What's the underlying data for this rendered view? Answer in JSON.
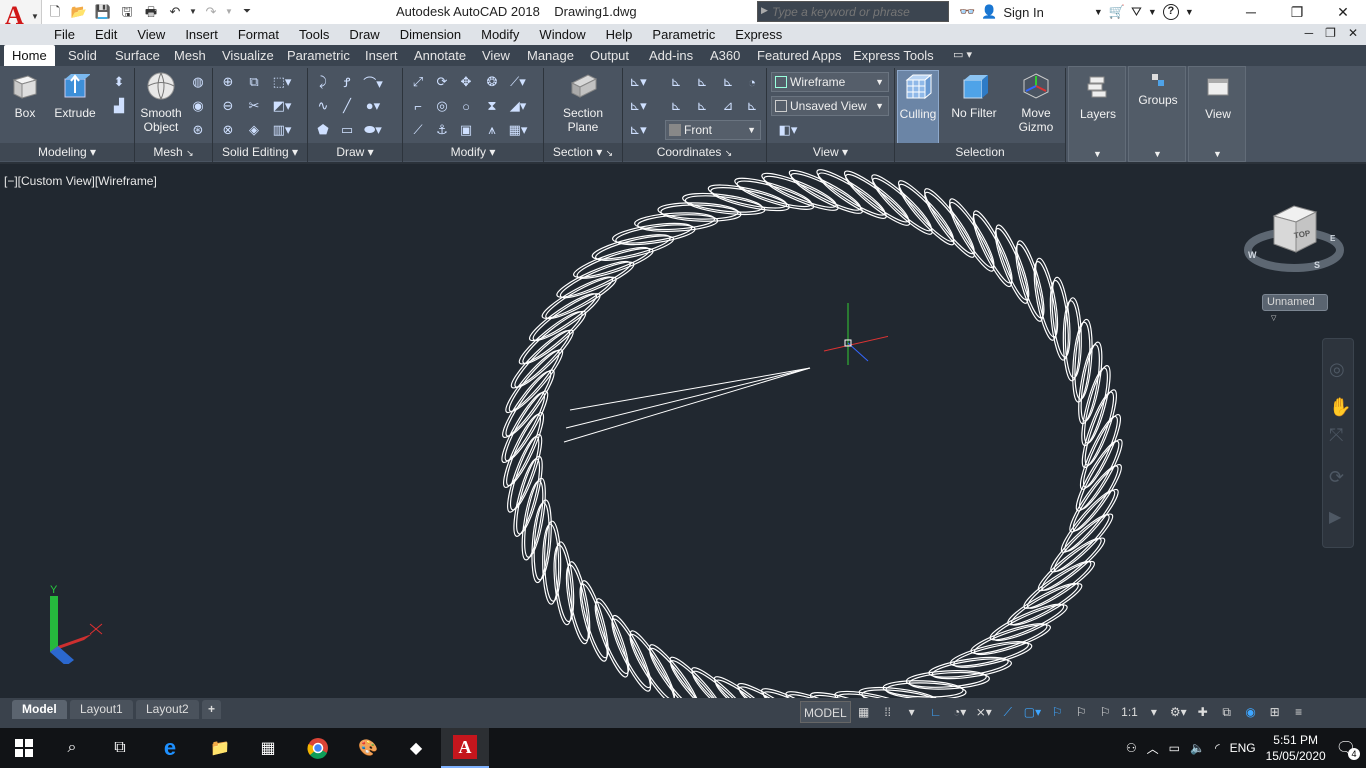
{
  "app": {
    "title": "Autodesk AutoCAD 2018",
    "document": "Drawing1.dwg",
    "logo_letter": "A"
  },
  "search": {
    "placeholder": "Type a keyword or phrase"
  },
  "account": {
    "sign_in": "Sign In"
  },
  "menu": [
    "File",
    "Edit",
    "View",
    "Insert",
    "Format",
    "Tools",
    "Draw",
    "Dimension",
    "Modify",
    "Window",
    "Help",
    "Parametric",
    "Express"
  ],
  "tabs": [
    "Home",
    "Solid",
    "Surface",
    "Mesh",
    "Visualize",
    "Parametric",
    "Insert",
    "Annotate",
    "View",
    "Manage",
    "Output",
    "Add-ins",
    "A360",
    "Featured Apps",
    "Express Tools"
  ],
  "active_tab": "Home",
  "ribbon": {
    "modeling": {
      "title": "Modeling",
      "box": "Box",
      "extrude": "Extrude"
    },
    "mesh": {
      "title": "Mesh",
      "smooth_object_1": "Smooth",
      "smooth_object_2": "Object"
    },
    "solid_editing": {
      "title": "Solid Editing"
    },
    "draw": {
      "title": "Draw"
    },
    "modify": {
      "title": "Modify"
    },
    "section": {
      "title": "Section",
      "section_plane_1": "Section",
      "section_plane_2": "Plane"
    },
    "coordinates": {
      "title": "Coordinates",
      "ucs_dropdown": "Front"
    },
    "view": {
      "title": "View",
      "visual_style": "Wireframe",
      "saved_view": "Unsaved View"
    },
    "selection": {
      "title": "Selection",
      "culling": "Culling",
      "no_filter": "No Filter",
      "move_gizmo_1": "Move",
      "move_gizmo_2": "Gizmo"
    },
    "layers": "Layers",
    "groups": "Groups",
    "view_panel": "View"
  },
  "viewport": {
    "label": "[−][Custom View][Wireframe]",
    "viewcube_face": "TOP",
    "compass": {
      "w": "W",
      "s": "S",
      "e": "E"
    },
    "ucs_dropdown": "Unnamed",
    "ucs_axis_y": "Y"
  },
  "layouts": [
    "Model",
    "Layout1",
    "Layout2"
  ],
  "status": {
    "model": "MODEL",
    "scale": "1:1"
  },
  "taskbar": {
    "language": "ENG",
    "time": "5:51 PM",
    "date": "15/05/2020",
    "notification_count": "4"
  },
  "colors": {
    "viewport_bg": "#212830",
    "ribbon_bg": "#4a5461",
    "accent_blue": "#3ea6ff",
    "wire": "#ffffff"
  }
}
